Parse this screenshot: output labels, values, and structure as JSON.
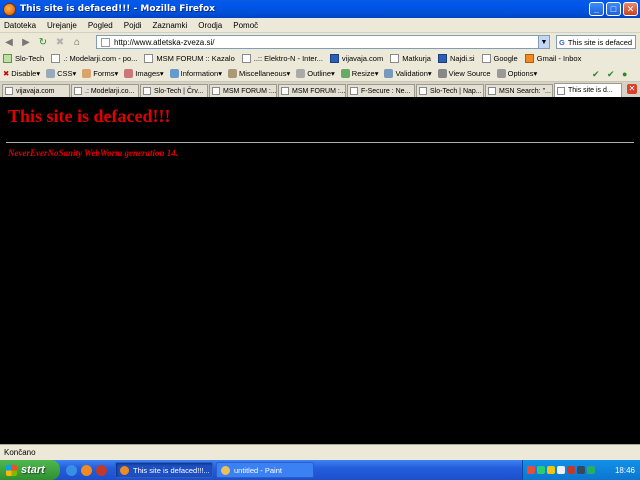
{
  "window": {
    "title": "This site is defaced!!! - Mozilla Firefox",
    "buttons": [
      "_",
      "□",
      "✕"
    ]
  },
  "menu": [
    "Datoteka",
    "Urejanje",
    "Pogled",
    "Pojdi",
    "Zaznamki",
    "Orodja",
    "Pomoč"
  ],
  "nav": {
    "url": "http://www.atletska-zveza.si/",
    "search_value": "This site is defaced"
  },
  "bookmarks": [
    "Slo-Tech",
    ".: Modelarji.com - po...",
    "MSM FORUM :: Kazalo",
    "..:: Elektro-N - Inter...",
    "vijavaja.com",
    "Matkurja",
    "Najdi.si",
    "Google",
    "Gmail - Inbox"
  ],
  "devtools": [
    "Disable",
    "CSS",
    "Forms",
    "Images",
    "Information",
    "Miscellaneous",
    "Outline",
    "Resize",
    "Validation",
    "View Source",
    "Options"
  ],
  "tabs": [
    {
      "label": "vijavaja.com",
      "active": false
    },
    {
      "label": ".: Modelarji.co...",
      "active": false
    },
    {
      "label": "Slo-Tech | Črv...",
      "active": false
    },
    {
      "label": "MSM FORUM :...",
      "active": false
    },
    {
      "label": "MSM FORUM :...",
      "active": false
    },
    {
      "label": "F-Secure : Ne...",
      "active": false
    },
    {
      "label": "Slo-Tech | Nap...",
      "active": false
    },
    {
      "label": "MSN Search: \"...",
      "active": false
    },
    {
      "label": "This site is d...",
      "active": true
    }
  ],
  "page": {
    "heading": "This site is defaced!!!",
    "subtext": "NeverEverNoSanity WebWorm generation 14."
  },
  "status": "Končano",
  "taskbar": {
    "start": "start",
    "tasks": [
      {
        "label": "This site is defaced!!!...",
        "active": true
      },
      {
        "label": "untitled - Paint",
        "active": false
      }
    ],
    "clock": "18:46"
  },
  "colors": {
    "deface_red": "#e00000",
    "page_bg": "#000000",
    "chrome_bg": "#ece9d8",
    "titlebar_blue": "#0058ee"
  }
}
